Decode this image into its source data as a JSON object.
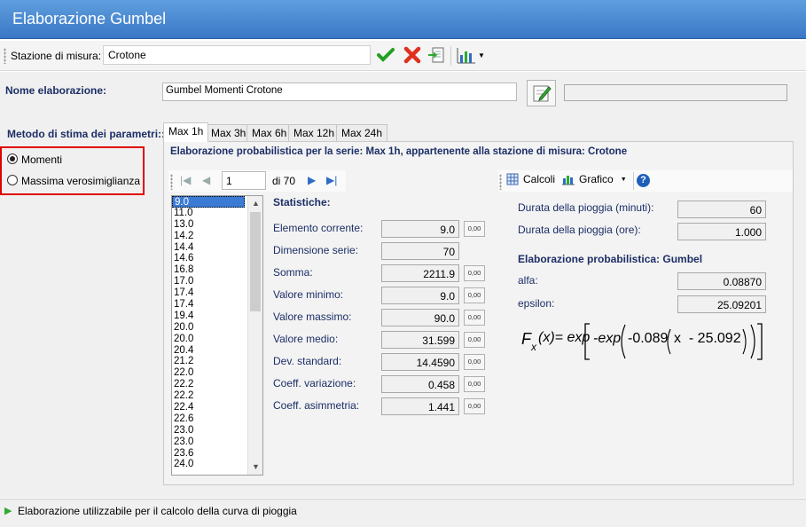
{
  "window": {
    "title": "Elaborazione Gumbel"
  },
  "toolbar": {
    "station_label": "Stazione di misura:",
    "station_value": "Crotone",
    "icons": [
      "check-icon",
      "cancel-icon",
      "export-icon",
      "chart-icon",
      "dropdown-arrow-icon"
    ]
  },
  "form": {
    "name_label": "Nome elaborazione:",
    "name_value": "Gumbel Momenti Crotone",
    "extra_value": "",
    "method_label": "Metodo di stima dei parametri::",
    "method_options": [
      {
        "label": "Momenti",
        "checked": true
      },
      {
        "label": "Massima verosimiglianza",
        "checked": false
      }
    ]
  },
  "tabs": [
    "Max 1h",
    "Max 3h",
    "Max 6h",
    "Max 12h",
    "Max 24h"
  ],
  "panel": {
    "heading": "Elaborazione probabilistica per la serie: Max 1h, appartenente alla stazione di misura: Crotone",
    "nav": {
      "current": "1",
      "total": "di 70"
    },
    "calcoli_label": "Calcoli",
    "grafico_label": "Grafico",
    "list": [
      "9.0",
      "11.0",
      "13.0",
      "14.2",
      "14.4",
      "14.6",
      "16.8",
      "17.0",
      "17.4",
      "17.4",
      "19.4",
      "20.0",
      "20.0",
      "20.4",
      "21.2",
      "22.0",
      "22.2",
      "22.2",
      "22.4",
      "22.6",
      "23.0",
      "23.0",
      "23.6",
      "24.0"
    ],
    "stats_title": "Statistiche:",
    "mini_label": "0,00",
    "stats": [
      {
        "label": "Elemento corrente:",
        "value": "9.0",
        "mini": true
      },
      {
        "label": "Dimensione serie:",
        "value": "70",
        "mini": false
      },
      {
        "label": "Somma:",
        "value": "2211.9",
        "mini": true
      },
      {
        "label": "Valore minimo:",
        "value": "9.0",
        "mini": true
      },
      {
        "label": "Valore massimo:",
        "value": "90.0",
        "mini": true
      },
      {
        "label": "Valore medio:",
        "value": "31.599",
        "mini": true
      },
      {
        "label": "Dev. standard:",
        "value": "14.4590",
        "mini": true
      },
      {
        "label": "Coeff. variazione:",
        "value": "0.458",
        "mini": true
      },
      {
        "label": "Coeff. asimmetria:",
        "value": "1.441",
        "mini": true
      }
    ],
    "durata_minuti_label": "Durata della pioggia (minuti):",
    "durata_minuti_value": "60",
    "durata_ore_label": "Durata della pioggia (ore):",
    "durata_ore_value": "1.000",
    "prob_title": "Elaborazione probabilistica: Gumbel",
    "alfa_label": "alfa:",
    "alfa_value": "0.08870",
    "epsilon_label": "epsilon:",
    "epsilon_value": "25.09201",
    "formula": {
      "lhs": "F",
      "lhs_sub": "x",
      "lhs_rest": "(x)= exp",
      "inner_exp": "-exp",
      "coef": "-0.089",
      "x_part": "x  - 25.092"
    }
  },
  "status": {
    "text": "Elaborazione utilizzabile per il calcolo della curva di pioggia"
  },
  "colors": {
    "title_bar": "#3a78c6",
    "accent_blue": "#1c2e66",
    "highlight_red": "#e00000",
    "status_green": "#2eaa2e"
  }
}
